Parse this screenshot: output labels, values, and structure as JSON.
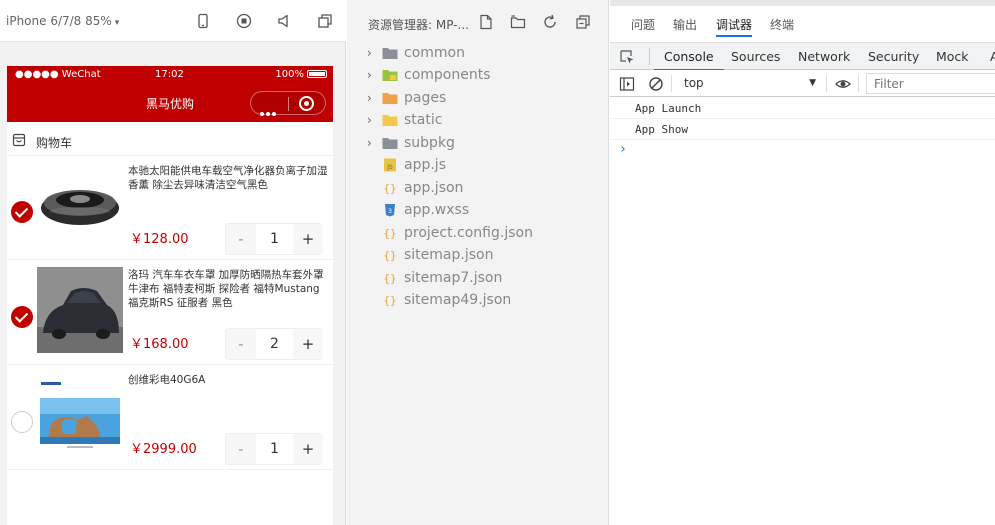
{
  "simulator": {
    "device": "iPhone 6/7/8 85%",
    "phone": {
      "carrier": "●●●●● WeChat",
      "time": "17:02",
      "battery": "100%",
      "nav_title": "黑马优购",
      "cart_label": "购物车",
      "items": [
        {
          "title": "本驰太阳能供电车载空气净化器负离子加湿香薰 除尘去异味清洁空气黑色",
          "price": "￥128.00",
          "qty": "1",
          "checked": true
        },
        {
          "title": "洛玛 汽车车衣车罩 加厚防晒隔热车套外罩牛津布 福特麦柯斯 探险者 福特Mustang 福克斯RS 征服者 黑色",
          "price": "￥168.00",
          "qty": "2",
          "checked": true
        },
        {
          "title": "创维彩电40G6A",
          "price": "￥2999.00",
          "qty": "1",
          "checked": false
        }
      ],
      "stepper_minus": "-",
      "stepper_plus": "+"
    }
  },
  "explorer": {
    "title": "资源管理器: MP-...",
    "folders": [
      "common",
      "components",
      "pages",
      "static",
      "subpkg"
    ],
    "files": [
      "app.js",
      "app.json",
      "app.wxss",
      "project.config.json",
      "sitemap.json",
      "sitemap7.json",
      "sitemap49.json"
    ]
  },
  "devtools": {
    "top_tabs": [
      "问题",
      "输出",
      "调试器",
      "终端"
    ],
    "tabs": [
      "Console",
      "Sources",
      "Network",
      "Security",
      "Mock",
      "A"
    ],
    "context": "top",
    "filter_placeholder": "Filter",
    "console_lines": [
      "App Launch",
      "App Show"
    ],
    "prompt": "›"
  },
  "colors": {
    "brand_red": "#c00000",
    "accent_blue": "#1a73e8"
  }
}
